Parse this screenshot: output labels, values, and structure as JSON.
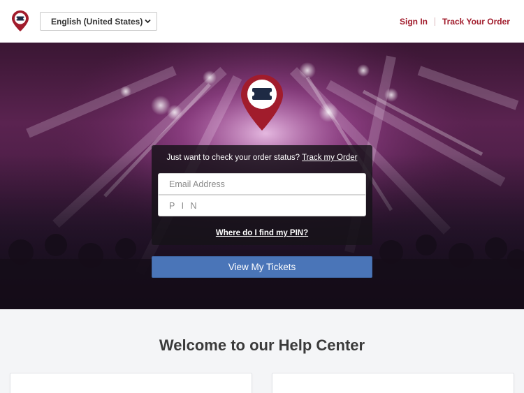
{
  "header": {
    "logo_icon": "ticket-pin-icon",
    "language": {
      "selected": "English (United States)",
      "icon": "chevron-down-icon"
    },
    "nav": {
      "sign_in": "Sign In",
      "track_order": "Track Your Order"
    }
  },
  "hero": {
    "pin_icon": "ticket-pin-icon",
    "status_prefix": "Just want to check your order status?",
    "status_link": "Track my Order",
    "email": {
      "placeholder": "Email Address",
      "value": ""
    },
    "pin": {
      "placeholder": "P I N",
      "value": ""
    },
    "pin_help": "Where do I find my PIN?",
    "submit": "View My Tickets"
  },
  "help": {
    "title": "Welcome to our Help Center"
  },
  "colors": {
    "brand": "#a11c2c",
    "button": "#4a75b8"
  }
}
